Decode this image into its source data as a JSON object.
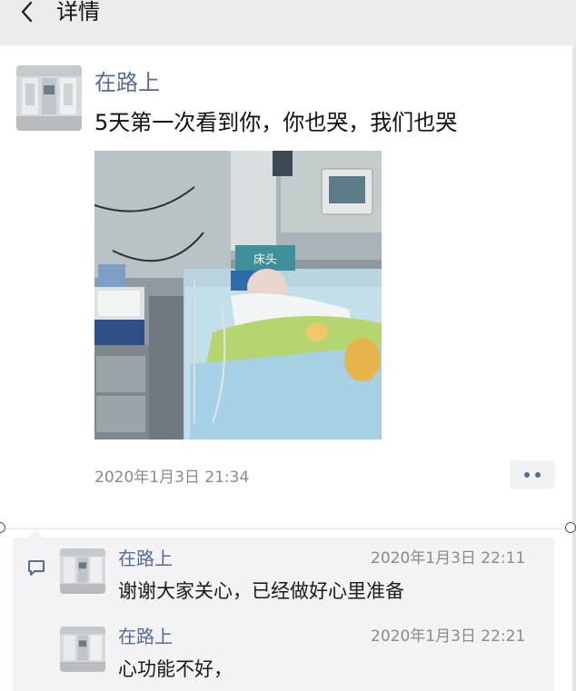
{
  "nav": {
    "title": "详情"
  },
  "post": {
    "author": "在路上",
    "text": "5天第一次看到你，你也哭，我们也哭",
    "photo_sign_text": "床头",
    "timestamp": "2020年1月3日 21:34"
  },
  "comments": [
    {
      "author": "在路上",
      "time": "2020年1月3日 22:11",
      "text": "谢谢大家关心，已经做好心里准备"
    },
    {
      "author": "在路上",
      "time": "2020年1月3日 22:21",
      "text": "心功能不好，"
    }
  ],
  "colors": {
    "link": "#576b95",
    "meta": "#8a8a8a",
    "nav_bg": "#ececec",
    "comment_bg": "#f3f3f5"
  },
  "icons": {
    "back": "chevron-left-icon",
    "more": "more-dots-icon",
    "comment": "comment-icon"
  }
}
